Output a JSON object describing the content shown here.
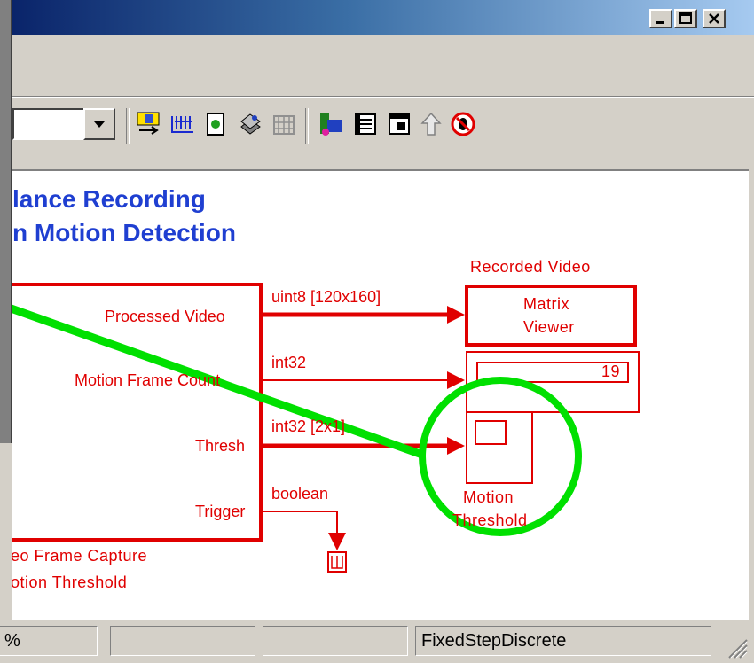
{
  "window": {
    "title_buttons": [
      "minimize",
      "maximize",
      "close"
    ]
  },
  "model": {
    "title_line1": "lance Recording",
    "title_line2": "n Motion Detection",
    "source_block": {
      "ports": [
        "Processed Video",
        "Motion Frame Count",
        "Thresh",
        "Trigger"
      ],
      "caption_line1": "eo Frame Capture",
      "caption_line2": "otion Threshold"
    },
    "signals": {
      "video": "uint8  [120x160]",
      "count": "int32",
      "thresh": "int32  [2x1]",
      "trigger": "boolean"
    },
    "recorded_video_label": "Recorded Video",
    "matrix_viewer_line1": "Matrix",
    "matrix_viewer_line2": "Viewer",
    "display_value": "19",
    "motion_threshold_line1": "Motion",
    "motion_threshold_line2": "Threshold"
  },
  "status": {
    "zoom": "%",
    "cell2": "",
    "cell3": "",
    "solver": "FixedStepDiscrete"
  },
  "colors": {
    "block_red": "#e00000",
    "title_blue": "#1f3fd1",
    "highlight_green": "#00e000"
  }
}
